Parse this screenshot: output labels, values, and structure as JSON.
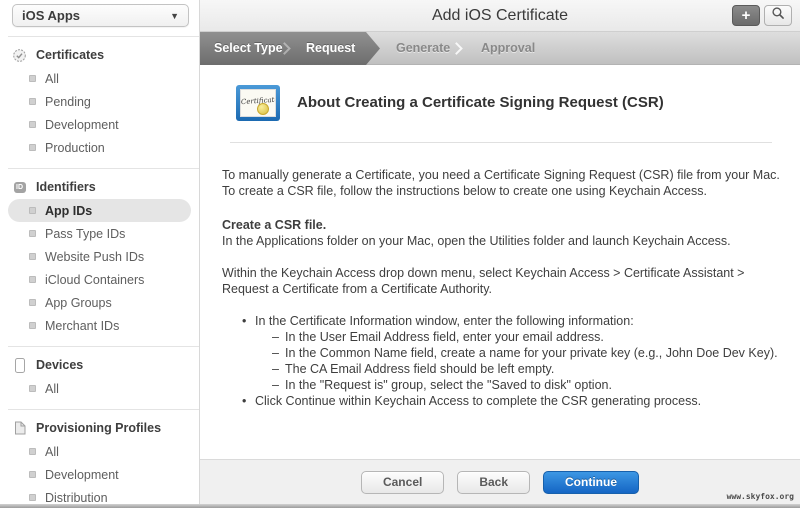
{
  "sidebar": {
    "apps_dropdown": {
      "label": "iOS Apps",
      "caret": "▼"
    },
    "sections": [
      {
        "label": "Certificates",
        "icon": "certificate-seal-icon",
        "items": [
          {
            "label": "All"
          },
          {
            "label": "Pending"
          },
          {
            "label": "Development"
          },
          {
            "label": "Production"
          }
        ]
      },
      {
        "label": "Identifiers",
        "icon": "id-badge-icon",
        "badge": "ID",
        "items": [
          {
            "label": "App IDs",
            "selected": true
          },
          {
            "label": "Pass Type IDs"
          },
          {
            "label": "Website Push IDs"
          },
          {
            "label": "iCloud Containers"
          },
          {
            "label": "App Groups"
          },
          {
            "label": "Merchant IDs"
          }
        ]
      },
      {
        "label": "Devices",
        "icon": "device-icon",
        "items": [
          {
            "label": "All"
          }
        ]
      },
      {
        "label": "Provisioning Profiles",
        "icon": "document-icon",
        "items": [
          {
            "label": "All"
          },
          {
            "label": "Development"
          },
          {
            "label": "Distribution"
          }
        ]
      }
    ]
  },
  "header": {
    "title": "Add iOS Certificate",
    "add_label": "+",
    "search_icon": "magnifier"
  },
  "steps": [
    {
      "label": "Select Type",
      "state": "active"
    },
    {
      "label": "Request",
      "state": "active"
    },
    {
      "label": "Generate",
      "state": "inactive"
    },
    {
      "label": "Approval",
      "state": "inactive"
    }
  ],
  "content": {
    "icon_word": "Certificate",
    "title": "About Creating a Certificate Signing Request (CSR)",
    "intro": "To manually generate a Certificate, you need a Certificate Signing Request (CSR) file from your Mac. To create a CSR file, follow the instructions below to create one using Keychain Access.",
    "subheading": "Create a CSR file.",
    "subtext": "In the Applications folder on your Mac, open the Utilities folder and launch Keychain Access.",
    "para2": "Within the Keychain Access drop down menu, select Keychain Access > Certificate Assistant > Request a Certificate from a Certificate Authority.",
    "bullet1": "In the Certificate Information window, enter the following information:",
    "sub_bullets": [
      "In the User Email Address field, enter your email address.",
      "In the Common Name field, create a name for your private key (e.g., John Doe Dev Key).",
      "The CA Email Address field should be left empty.",
      "In the \"Request is\" group, select the \"Saved to disk\" option."
    ],
    "bullet2": "Click Continue within Keychain Access to complete the CSR generating process."
  },
  "footer": {
    "cancel": "Cancel",
    "back": "Back",
    "continue": "Continue"
  },
  "watermark": "www.skyfox.org",
  "colors": {
    "accent_blue": "#1a7ad9",
    "step_dark": "#787878",
    "selected_bg": "#e5e5e5"
  }
}
